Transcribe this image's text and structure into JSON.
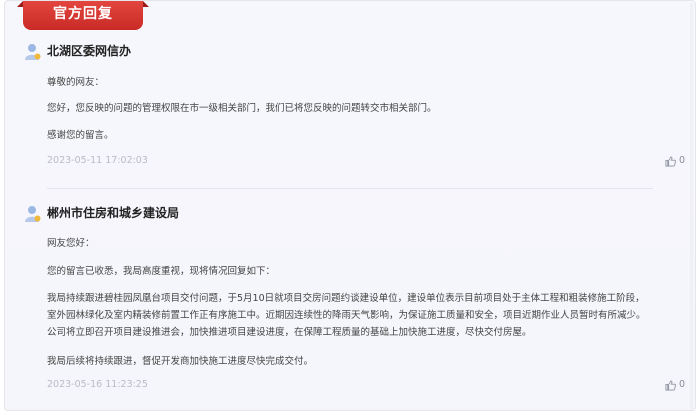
{
  "header": {
    "title": "官方回复"
  },
  "replies": [
    {
      "department": "北湖区委网信办",
      "paragraphs": [
        "尊敬的网友：",
        "您好，您反映的问题的管理权限在市一级相关部门，我们已将您反映的问题转交市相关部门。",
        "感谢您的留言。"
      ],
      "timestamp": "2023-05-11 17:02:03",
      "likes": "0"
    },
    {
      "department": "郴州市住房和城乡建设局",
      "paragraphs": [
        "网友您好：",
        "您的留言已收悉，我局高度重视，现将情况回复如下：",
        "我局持续跟进碧桂园凤凰台项目交付问题，于5月10日就项目交房问题约谈建设单位，建设单位表示目前项目处于主体工程和粗装修施工阶段，",
        "室外园林绿化及室内精装修前置工作正有序施工中。近期因连续性的降雨天气影响，为保证施工质量和安全，项目近期作业人员暂时有所减少。",
        "公司将立即召开项目建设推进会，加快推进项目建设进度，在保障工程质量的基础上加快施工进度，尽快交付房屋。",
        "我局后续将持续跟进，督促开发商加快施工进度尽快完成交付。"
      ],
      "timestamp": "2023-05-16 11:23:25",
      "likes": "0"
    }
  ],
  "icons": {
    "avatar": "user-avatar-icon",
    "like": "thumbs-up-icon"
  },
  "colors": {
    "accent": "#d3302b",
    "timestamp": "#b9bcc8",
    "background": "#f6f7fc"
  }
}
